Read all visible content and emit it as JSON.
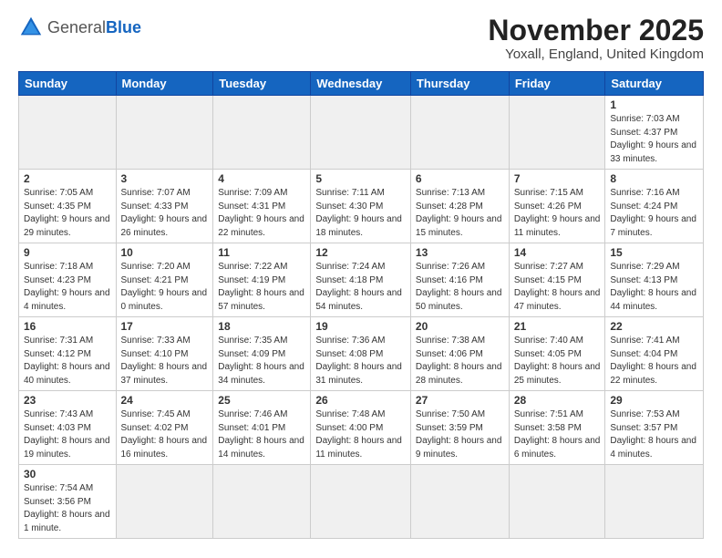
{
  "header": {
    "logo_general": "General",
    "logo_blue": "Blue",
    "month_title": "November 2025",
    "subtitle": "Yoxall, England, United Kingdom"
  },
  "days_of_week": [
    "Sunday",
    "Monday",
    "Tuesday",
    "Wednesday",
    "Thursday",
    "Friday",
    "Saturday"
  ],
  "weeks": [
    [
      {
        "day": "",
        "info": "",
        "empty": true
      },
      {
        "day": "",
        "info": "",
        "empty": true
      },
      {
        "day": "",
        "info": "",
        "empty": true
      },
      {
        "day": "",
        "info": "",
        "empty": true
      },
      {
        "day": "",
        "info": "",
        "empty": true
      },
      {
        "day": "",
        "info": "",
        "empty": true
      },
      {
        "day": "1",
        "info": "Sunrise: 7:03 AM\nSunset: 4:37 PM\nDaylight: 9 hours\nand 33 minutes."
      }
    ],
    [
      {
        "day": "2",
        "info": "Sunrise: 7:05 AM\nSunset: 4:35 PM\nDaylight: 9 hours\nand 29 minutes."
      },
      {
        "day": "3",
        "info": "Sunrise: 7:07 AM\nSunset: 4:33 PM\nDaylight: 9 hours\nand 26 minutes."
      },
      {
        "day": "4",
        "info": "Sunrise: 7:09 AM\nSunset: 4:31 PM\nDaylight: 9 hours\nand 22 minutes."
      },
      {
        "day": "5",
        "info": "Sunrise: 7:11 AM\nSunset: 4:30 PM\nDaylight: 9 hours\nand 18 minutes."
      },
      {
        "day": "6",
        "info": "Sunrise: 7:13 AM\nSunset: 4:28 PM\nDaylight: 9 hours\nand 15 minutes."
      },
      {
        "day": "7",
        "info": "Sunrise: 7:15 AM\nSunset: 4:26 PM\nDaylight: 9 hours\nand 11 minutes."
      },
      {
        "day": "8",
        "info": "Sunrise: 7:16 AM\nSunset: 4:24 PM\nDaylight: 9 hours\nand 7 minutes."
      }
    ],
    [
      {
        "day": "9",
        "info": "Sunrise: 7:18 AM\nSunset: 4:23 PM\nDaylight: 9 hours\nand 4 minutes."
      },
      {
        "day": "10",
        "info": "Sunrise: 7:20 AM\nSunset: 4:21 PM\nDaylight: 9 hours\nand 0 minutes."
      },
      {
        "day": "11",
        "info": "Sunrise: 7:22 AM\nSunset: 4:19 PM\nDaylight: 8 hours\nand 57 minutes."
      },
      {
        "day": "12",
        "info": "Sunrise: 7:24 AM\nSunset: 4:18 PM\nDaylight: 8 hours\nand 54 minutes."
      },
      {
        "day": "13",
        "info": "Sunrise: 7:26 AM\nSunset: 4:16 PM\nDaylight: 8 hours\nand 50 minutes."
      },
      {
        "day": "14",
        "info": "Sunrise: 7:27 AM\nSunset: 4:15 PM\nDaylight: 8 hours\nand 47 minutes."
      },
      {
        "day": "15",
        "info": "Sunrise: 7:29 AM\nSunset: 4:13 PM\nDaylight: 8 hours\nand 44 minutes."
      }
    ],
    [
      {
        "day": "16",
        "info": "Sunrise: 7:31 AM\nSunset: 4:12 PM\nDaylight: 8 hours\nand 40 minutes."
      },
      {
        "day": "17",
        "info": "Sunrise: 7:33 AM\nSunset: 4:10 PM\nDaylight: 8 hours\nand 37 minutes."
      },
      {
        "day": "18",
        "info": "Sunrise: 7:35 AM\nSunset: 4:09 PM\nDaylight: 8 hours\nand 34 minutes."
      },
      {
        "day": "19",
        "info": "Sunrise: 7:36 AM\nSunset: 4:08 PM\nDaylight: 8 hours\nand 31 minutes."
      },
      {
        "day": "20",
        "info": "Sunrise: 7:38 AM\nSunset: 4:06 PM\nDaylight: 8 hours\nand 28 minutes."
      },
      {
        "day": "21",
        "info": "Sunrise: 7:40 AM\nSunset: 4:05 PM\nDaylight: 8 hours\nand 25 minutes."
      },
      {
        "day": "22",
        "info": "Sunrise: 7:41 AM\nSunset: 4:04 PM\nDaylight: 8 hours\nand 22 minutes."
      }
    ],
    [
      {
        "day": "23",
        "info": "Sunrise: 7:43 AM\nSunset: 4:03 PM\nDaylight: 8 hours\nand 19 minutes."
      },
      {
        "day": "24",
        "info": "Sunrise: 7:45 AM\nSunset: 4:02 PM\nDaylight: 8 hours\nand 16 minutes."
      },
      {
        "day": "25",
        "info": "Sunrise: 7:46 AM\nSunset: 4:01 PM\nDaylight: 8 hours\nand 14 minutes."
      },
      {
        "day": "26",
        "info": "Sunrise: 7:48 AM\nSunset: 4:00 PM\nDaylight: 8 hours\nand 11 minutes."
      },
      {
        "day": "27",
        "info": "Sunrise: 7:50 AM\nSunset: 3:59 PM\nDaylight: 8 hours\nand 9 minutes."
      },
      {
        "day": "28",
        "info": "Sunrise: 7:51 AM\nSunset: 3:58 PM\nDaylight: 8 hours\nand 6 minutes."
      },
      {
        "day": "29",
        "info": "Sunrise: 7:53 AM\nSunset: 3:57 PM\nDaylight: 8 hours\nand 4 minutes."
      }
    ],
    [
      {
        "day": "30",
        "info": "Sunrise: 7:54 AM\nSunset: 3:56 PM\nDaylight: 8 hours\nand 1 minute."
      },
      {
        "day": "",
        "info": "",
        "empty": true
      },
      {
        "day": "",
        "info": "",
        "empty": true
      },
      {
        "day": "",
        "info": "",
        "empty": true
      },
      {
        "day": "",
        "info": "",
        "empty": true
      },
      {
        "day": "",
        "info": "",
        "empty": true
      },
      {
        "day": "",
        "info": "",
        "empty": true
      }
    ]
  ]
}
